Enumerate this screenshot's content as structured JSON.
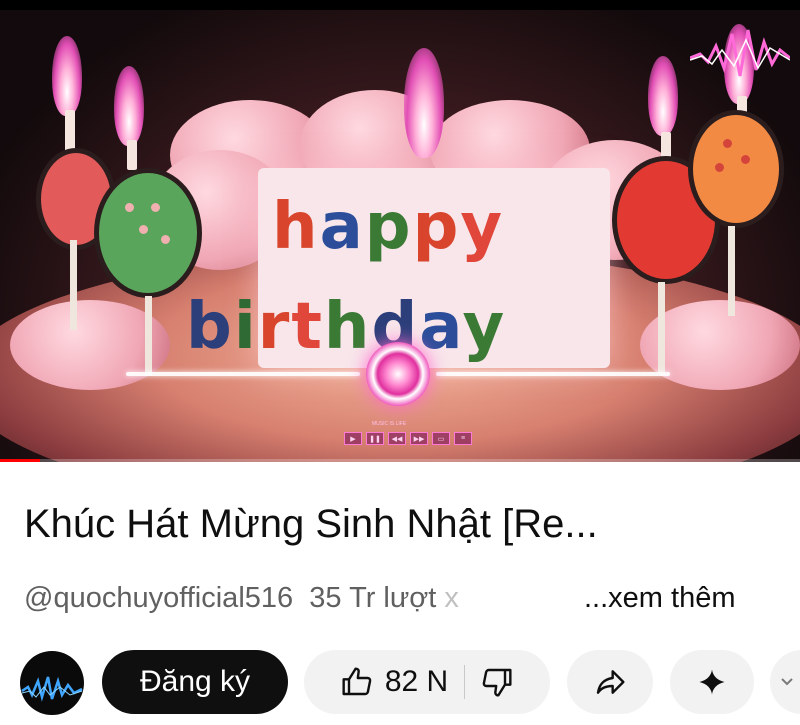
{
  "video": {
    "cake_text_line1": "happy",
    "cake_text_line2": "birthday",
    "player_caption": "MUSIC IS LIFE",
    "player_controls": [
      "play-icon",
      "pause-icon",
      "rewind-icon",
      "forward-icon",
      "loop-icon",
      "playlist-icon"
    ],
    "progress_fraction": 0.05,
    "colors": {
      "progress": "#ff0000",
      "neon": "#ff4fd0"
    }
  },
  "info": {
    "title": "Khúc Hát Mừng Sinh Nhật [Re...",
    "channel_handle": "@quochuyofficial516",
    "views": "35 Tr lượt",
    "views_fade": "x",
    "more_label": "...xem thêm"
  },
  "actions": {
    "subscribe_label": "Đăng ký",
    "like_count": "82 N",
    "icons": [
      "thumbs-up-icon",
      "thumbs-down-icon",
      "share-icon",
      "sparkle-icon"
    ]
  }
}
